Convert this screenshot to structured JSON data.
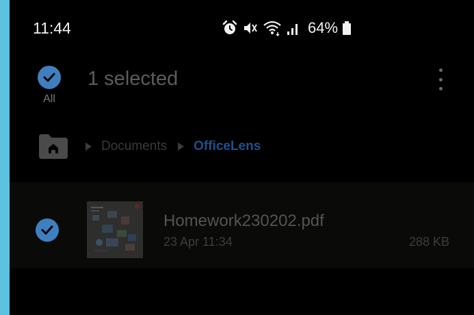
{
  "status_bar": {
    "time": "11:44",
    "battery_percent": "64%",
    "icons": [
      "alarm-icon",
      "mute-icon",
      "wifi-icon",
      "signal-icon",
      "battery-icon"
    ]
  },
  "selection": {
    "all_label": "All",
    "title": "1 selected"
  },
  "breadcrumb": {
    "items": [
      "Documents",
      "OfficeLens"
    ]
  },
  "files": [
    {
      "name": "Homework230202.pdf",
      "date": "23 Apr 11:34",
      "size": "288 KB",
      "selected": true
    }
  ],
  "colors": {
    "accent": "#3f7fbf",
    "background": "#000000",
    "side_bar": "#5bc3df"
  }
}
